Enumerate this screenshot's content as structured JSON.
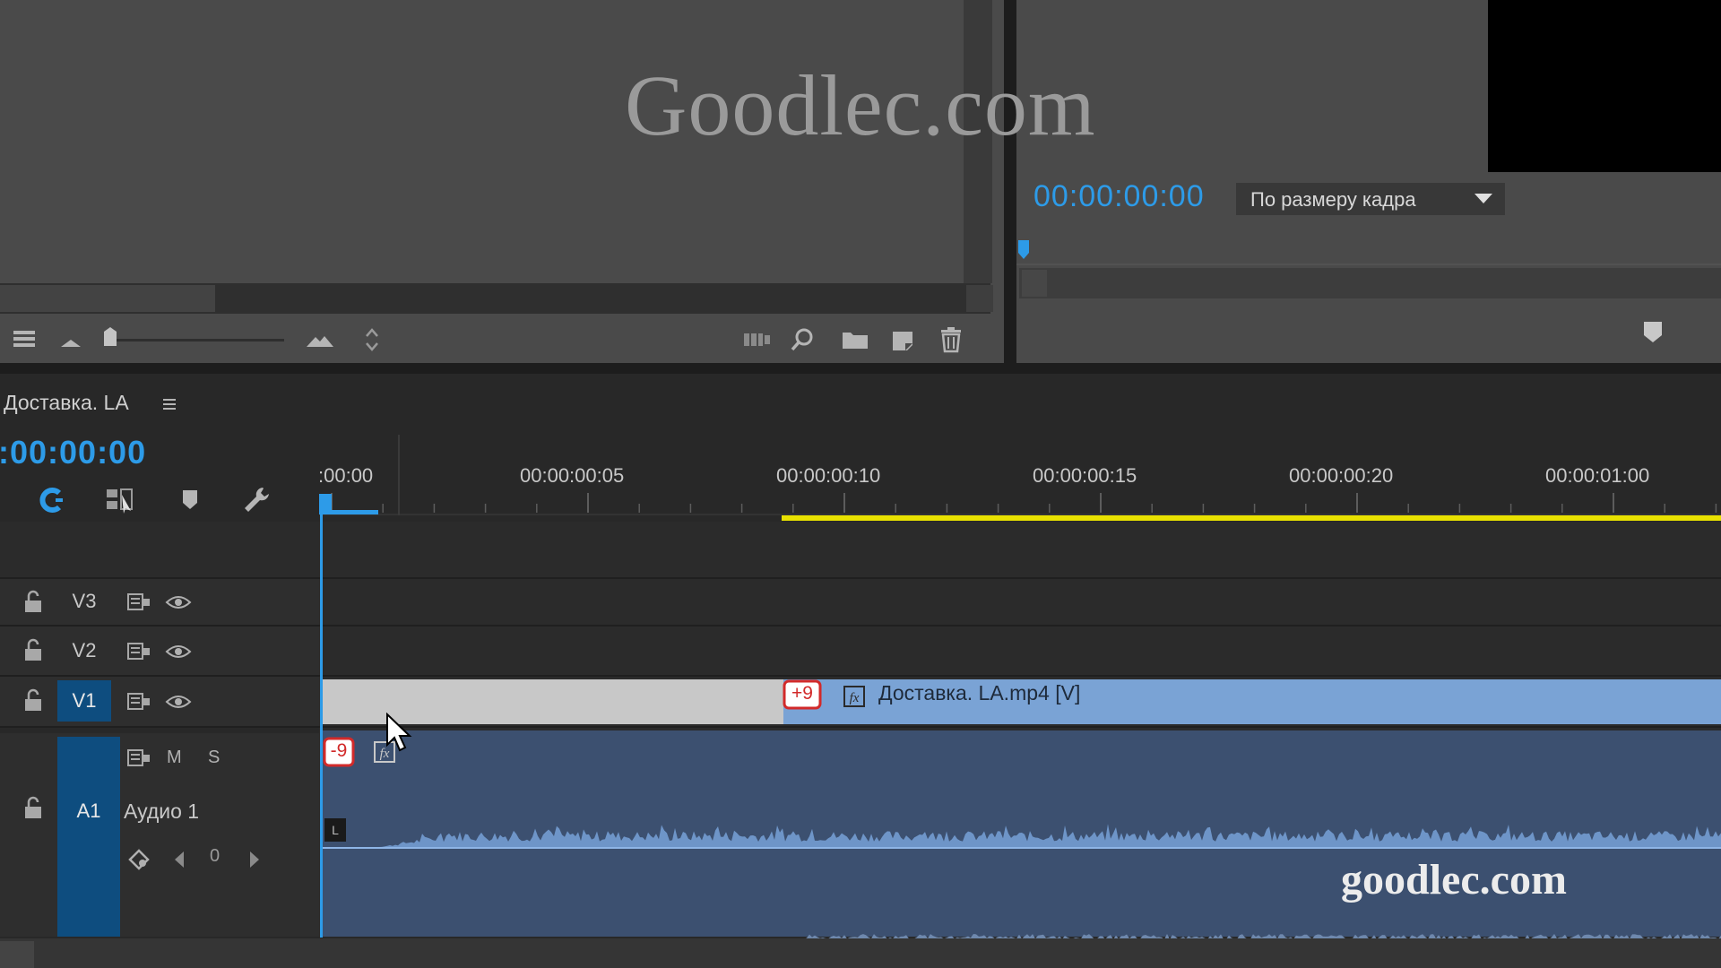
{
  "watermark": {
    "top": "Goodlec.com",
    "bottom": "goodlec.com"
  },
  "program_monitor": {
    "timecode": "00:00:00:00",
    "fit_option": "По размеру кадра"
  },
  "sequence": {
    "name": "Доставка. LA",
    "timecode": ":00:00:00"
  },
  "ruler": {
    "labels": [
      ":00:00",
      "00:00:00:05",
      "00:00:00:10",
      "00:00:00:15",
      "00:00:00:20",
      "00:00:01:00"
    ]
  },
  "tracks": {
    "v3": "V3",
    "v2": "V2",
    "v1": "V1",
    "a1": "A1",
    "a1_name": "Аудио 1",
    "mute": "M",
    "solo": "S",
    "volume_value": "0"
  },
  "clips": {
    "video_label": "Доставка. LA.mp4 [V]",
    "video_offset": "+9",
    "audio_offset": "-9",
    "audio_channel": "L"
  },
  "colors": {
    "accent_timecode": "#2d9be8",
    "work_area": "#e8e100",
    "video_clip": "#7aa3d5",
    "audio_clip": "#3c5070",
    "target_track": "#0e4d7f",
    "offset_badge": "#d22a2a"
  }
}
